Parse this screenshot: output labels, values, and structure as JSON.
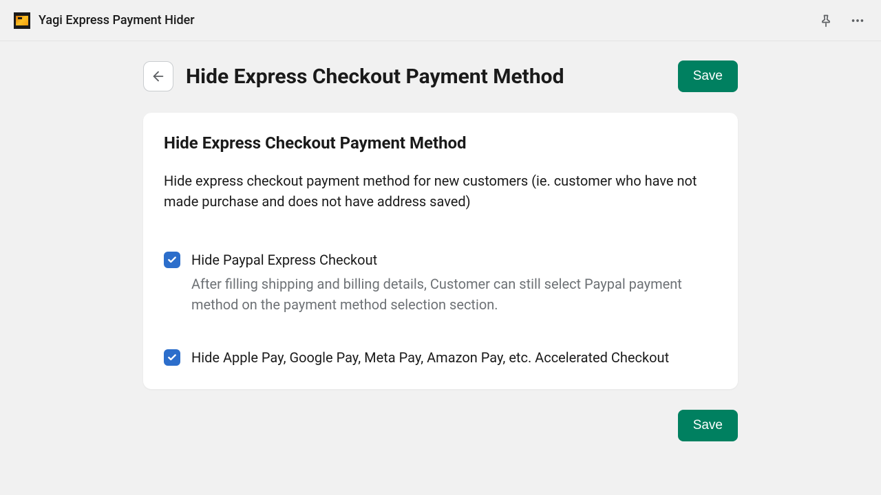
{
  "topbar": {
    "app_name": "Yagi Express Payment Hider"
  },
  "page": {
    "title": "Hide Express Checkout Payment Method",
    "save_label": "Save"
  },
  "card": {
    "title": "Hide Express Checkout Payment Method",
    "description": "Hide express checkout payment method for new customers (ie. customer who have not made purchase and does not have address saved)"
  },
  "options": [
    {
      "label": "Hide Paypal Express Checkout",
      "help": "After filling shipping and billing details, Customer can still select Paypal payment method on the payment method selection section.",
      "checked": true
    },
    {
      "label": "Hide Apple Pay, Google Pay, Meta Pay, Amazon Pay, etc. Accelerated Checkout",
      "help": "",
      "checked": true
    }
  ],
  "footer": {
    "save_label": "Save"
  }
}
